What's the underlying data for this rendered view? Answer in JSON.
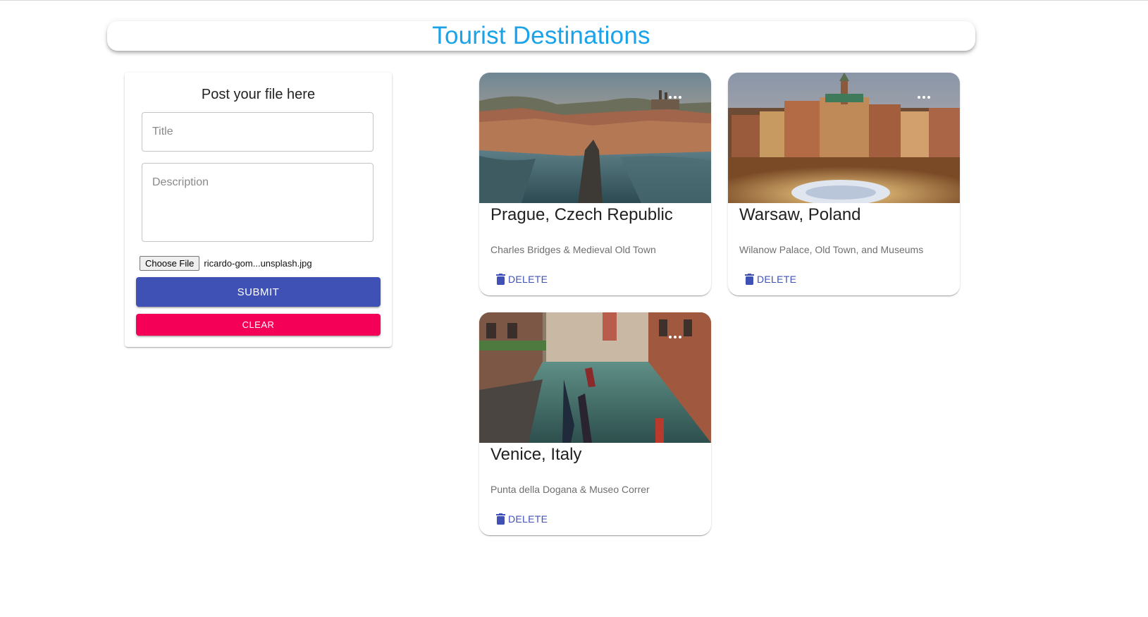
{
  "app": {
    "title": "Tourist Destinations",
    "accent_color": "#1aa3e8"
  },
  "form": {
    "heading": "Post your file here",
    "title_placeholder": "Title",
    "description_placeholder": "Description",
    "choose_file_label": "Choose File",
    "file_name": "ricardo-gom...unsplash.jpg",
    "submit_label": "SUBMIT",
    "clear_label": "CLEAR",
    "submit_color": "#3f51b5",
    "clear_color": "#f50057"
  },
  "posts": [
    {
      "title": "Prague, Czech Republic",
      "description": "Charles Bridges & Medieval Old Town",
      "delete_label": "DELETE",
      "menu_icon": "more-horiz-icon"
    },
    {
      "title": "Warsaw, Poland",
      "description": "Wilanow Palace, Old Town, and Museums",
      "delete_label": "DELETE",
      "menu_icon": "more-horiz-icon"
    },
    {
      "title": "Venice, Italy",
      "description": "Punta della Dogana & Museo Correr",
      "delete_label": "DELETE",
      "menu_icon": "more-horiz-icon"
    }
  ]
}
